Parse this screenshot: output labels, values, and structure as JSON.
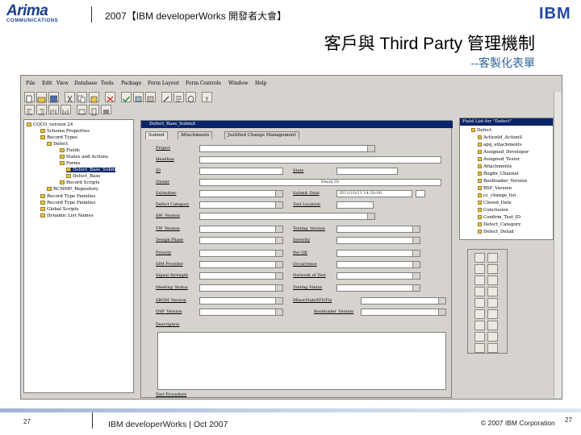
{
  "header": {
    "logo_text": "Arima",
    "logo_sub": "COMMUNICATIONS",
    "title": "2007【IBM developerWorks 開發者大會】",
    "brand": "IBM"
  },
  "slide": {
    "title": "客戶與 Third Party 管理機制",
    "subtitle": "--客製化表單"
  },
  "app": {
    "menu": [
      "File",
      "Edit",
      "View",
      "Database",
      "Tools",
      "Package",
      "Form Layout",
      "Form Controls",
      "Window",
      "Help"
    ],
    "tree": [
      {
        "label": "CQCO_version 24",
        "indent": 0
      },
      {
        "label": "Schema Properties",
        "indent": 1
      },
      {
        "label": "Record Types",
        "indent": 1
      },
      {
        "label": "Defect",
        "indent": 2
      },
      {
        "label": "Fields",
        "indent": 3
      },
      {
        "label": "States and Actions",
        "indent": 3
      },
      {
        "label": "Forms",
        "indent": 3
      },
      {
        "label": "Defect_Base_Subm",
        "indent": 4,
        "selected": true
      },
      {
        "label": "Defect_Base",
        "indent": 4
      },
      {
        "label": "Record Scripts",
        "indent": 3
      },
      {
        "label": "RCMMP_Repository",
        "indent": 2
      },
      {
        "label": "Record Type Families",
        "indent": 1
      },
      {
        "label": "Record Type Families",
        "indent": 1
      },
      {
        "label": "Global Scripts",
        "indent": 1
      },
      {
        "label": "Dynamic List Names",
        "indent": 1
      }
    ],
    "form_title": "Defect_Base_Submit",
    "tabs": [
      "Submit",
      "Attachments",
      "Justified Change Management"
    ],
    "fields": {
      "project": "Project",
      "headline": "Headline",
      "id": "ID",
      "state": "State",
      "owner": "Owner",
      "owner_value": "Email ID",
      "submitter": "Submitter",
      "submit_date": "Submit_Date",
      "submit_date_value": "2011/10/11 14:30:00",
      "defect_category": "Defect Category",
      "test_location": "Test Location",
      "sw_version": "SW_Version",
      "tw_version": "TW_Version",
      "testing_version": "Testing_Version",
      "design_phase": "Design Phase",
      "severity": "Severity",
      "priority": "Priority",
      "per_ok": "Per OK",
      "sim_provider": "SIM Provider",
      "occurrence": "Occurrence",
      "signal_strength": "Signal Strength",
      "network_test": "Network of Test",
      "meeting_status": "Meeting_Status",
      "testing_status": "Testing Status",
      "sbom_version": "SBOM_Version",
      "minor_sub": "Minor/Sub/ATS/Fix",
      "osp_version": "OSP_Version",
      "bootloader_version": "Bootloader_Version",
      "description": "Description",
      "test_procedure": "Test Procedure"
    },
    "field_list_title": "Field List for \"Defect\"",
    "field_list": [
      "Defect",
      "ActionId_ActionS",
      "apq_attachments",
      "Assigned_Developer",
      "Assigned_Tester",
      "Attachments",
      "Bugfix_Channel",
      "Bootloader_Version",
      "BSP_Version",
      "cc_change_list",
      "Closed_Date",
      "Conclusion",
      "Confirm_Test_ID",
      "Defect_Category",
      "Defect_Detail"
    ]
  },
  "footer": {
    "page_num": "27",
    "text": "IBM developerWorks | Oct 2007",
    "copyright": "© 2007 IBM Corporation",
    "page_small": "27"
  },
  "colors": {
    "accent": "#0a246a",
    "brand": "#2448a8",
    "subtitle": "#336699"
  }
}
